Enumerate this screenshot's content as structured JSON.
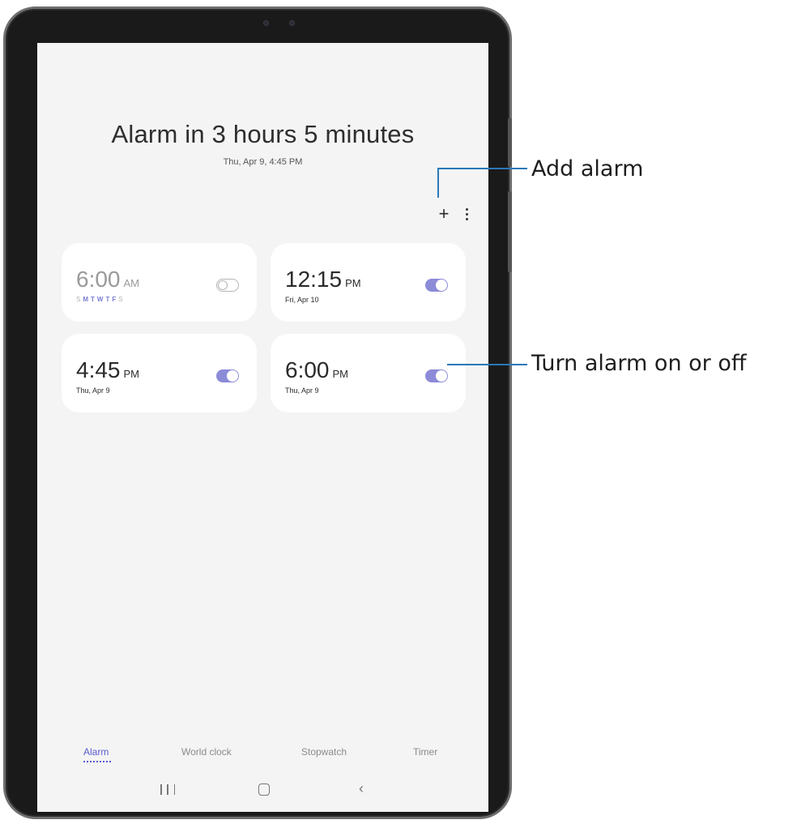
{
  "screen": {
    "summary_title": "Alarm in 3 hours 5 minutes",
    "summary_subtitle": "Thu, Apr 9, 4:45 PM",
    "add_icon": "+",
    "more_icon": "more-vertical"
  },
  "alarms": [
    {
      "time": "6:00",
      "ampm": "AM",
      "enabled": false,
      "days": [
        "S",
        "M",
        "T",
        "W",
        "T",
        "F",
        "S"
      ]
    },
    {
      "time": "12:15",
      "ampm": "PM",
      "enabled": true,
      "date": "Fri, Apr 10"
    },
    {
      "time": "4:45",
      "ampm": "PM",
      "enabled": true,
      "date": "Thu, Apr 9"
    },
    {
      "time": "6:00",
      "ampm": "PM",
      "enabled": true,
      "date": "Thu, Apr 9"
    }
  ],
  "tabs": [
    "Alarm",
    "World clock",
    "Stopwatch",
    "Timer"
  ],
  "nav": {
    "recent_icon": "recent-apps",
    "home_icon": "home",
    "back_icon": "‹"
  },
  "callouts": {
    "add_alarm": "Add alarm",
    "toggle": "Turn alarm on or off"
  },
  "colors": {
    "accent": "#8b8bd8",
    "active_tab": "#5a5ad0",
    "callout_line": "#2b78b8"
  }
}
